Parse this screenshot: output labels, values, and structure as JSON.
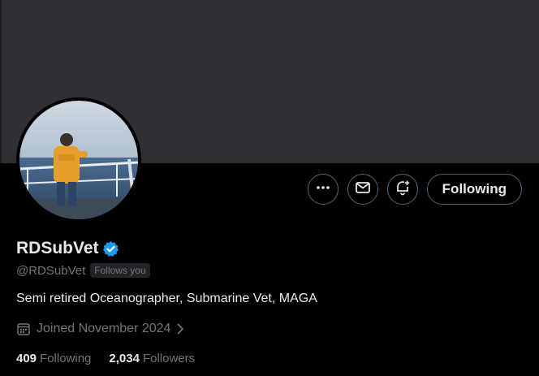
{
  "profile": {
    "display_name": "RDSubVet",
    "handle": "@RDSubVet",
    "follows_you_label": "Follows you",
    "verified": true,
    "bio": "Semi retired Oceanographer, Submarine Vet, MAGA",
    "joined": "Joined November 2024"
  },
  "actions": {
    "more_icon": "more-horizontal-icon",
    "message_icon": "mail-icon",
    "notify_icon": "bell-plus-icon",
    "follow_label": "Following"
  },
  "stats": {
    "following_count": "409",
    "following_label": "Following",
    "followers_count": "2,034",
    "followers_label": "Followers"
  },
  "colors": {
    "background": "#000000",
    "banner": "#2f3033",
    "muted_text": "#71767b",
    "verified_badge": "#1d9bf0"
  }
}
